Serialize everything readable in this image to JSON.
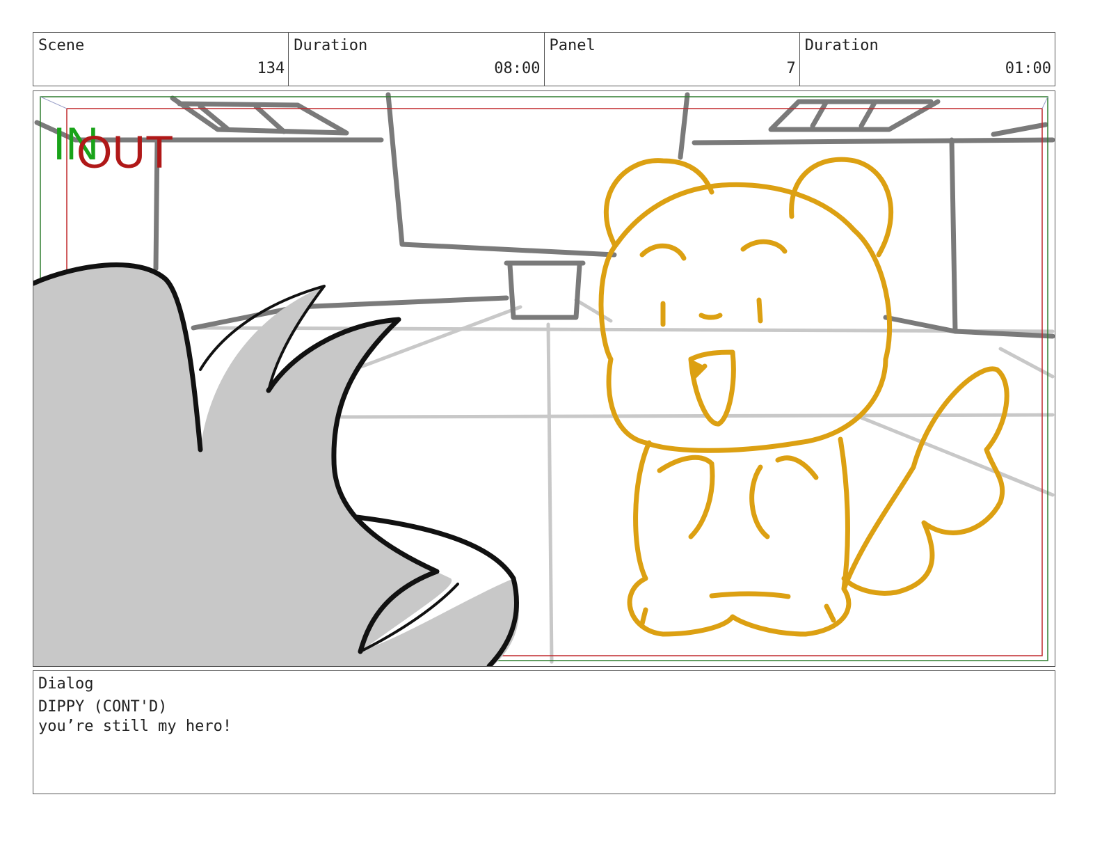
{
  "header": {
    "scene_label": "Scene",
    "scene_value": "134",
    "duration_label": "Duration",
    "duration_value": "08:00",
    "panel_label": "Panel",
    "panel_value": "7",
    "panel_duration_label": "Duration",
    "panel_duration_value": "01:00"
  },
  "frame": {
    "in_label": "IN",
    "out_label": "OUT",
    "in_color": "#19a319",
    "out_color": "#b01818",
    "character_color": "#dca012"
  },
  "dialog": {
    "label": "Dialog",
    "lines": [
      "DIPPY (CONT'D)",
      "you’re still my hero!"
    ]
  }
}
